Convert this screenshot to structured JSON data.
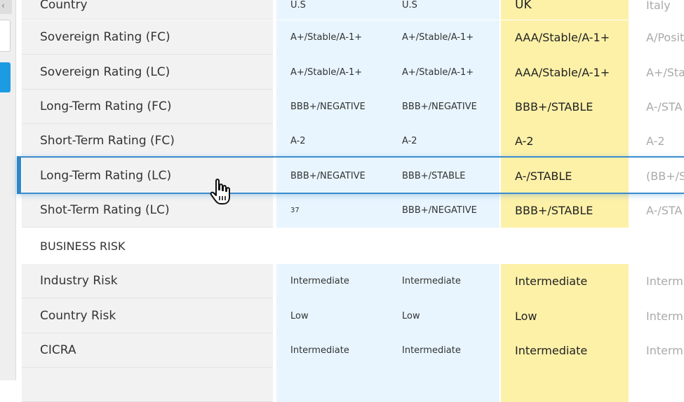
{
  "table": {
    "header": {
      "label": "Country",
      "values": [
        "U.S",
        "U.S",
        "UK",
        "Italy"
      ]
    },
    "rows": [
      {
        "label": "Sovereign Rating (FC)",
        "values": [
          "A+/Stable/A-1+",
          "A+/Stable/A-1+",
          "AAA/Stable/A-1+",
          "A/Posit"
        ]
      },
      {
        "label": "Sovereign Rating (LC)",
        "values": [
          "A+/Stable/A-1+",
          "A+/Stable/A-1+",
          "AAA/Stable/A-1+",
          "A+/Stal"
        ]
      },
      {
        "label": "Long-Term Rating (FC)",
        "values": [
          "BBB+/NEGATIVE",
          "BBB+/NEGATIVE",
          "BBB+/STABLE",
          "A-/STA"
        ]
      },
      {
        "label": "Short-Term Rating (FC)",
        "values": [
          "A-2",
          "A-2",
          "A-2",
          "A-2"
        ]
      },
      {
        "label": "Long-Term Rating (LC)",
        "values": [
          "BBB+/NEGATIVE",
          "BBB+/STABLE",
          "A-/STABLE",
          "(BB+/S"
        ]
      },
      {
        "label": "Shot-Term Rating (LC)",
        "values": [
          "37",
          "BBB+/NEGATIVE",
          "BBB+/STABLE",
          "A-/STA"
        ]
      }
    ],
    "section": {
      "label": "BUSINESS RISK"
    },
    "rows2": [
      {
        "label": "Industry Risk",
        "values": [
          "Intermediate",
          "Intermediate",
          "Intermediate",
          "Interm"
        ]
      },
      {
        "label": "Country Risk",
        "values": [
          "Low",
          "Low",
          "Low",
          "Interm"
        ]
      },
      {
        "label": "CICRA",
        "values": [
          "Intermediate",
          "Intermediate",
          "Intermediate",
          "Interm"
        ]
      }
    ]
  },
  "colors": {
    "label_bg": "#f2f2f2",
    "blue_col_bg": "#e8f5fe",
    "yellow_col_bg": "#fdf1a8",
    "highlight": "#3a8ccf",
    "button_blue": "#1c9be2"
  },
  "icons": {
    "cursor": "hand-pointer-icon",
    "left_chevron": "chevron-left-icon"
  }
}
